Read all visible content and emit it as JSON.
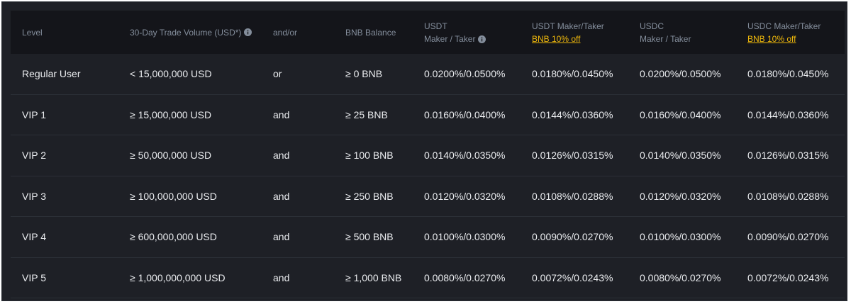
{
  "table": {
    "headers": {
      "level": "Level",
      "volume": "30-Day Trade Volume (USD*)",
      "andor": "and/or",
      "bnb": "BNB Balance",
      "usdt_line1": "USDT",
      "usdt_line2": "Maker / Taker",
      "usdt_disc_line1": "USDT Maker/Taker",
      "usdt_disc_line2": "BNB 10% off",
      "usdc_line1": "USDC",
      "usdc_line2": "Maker / Taker",
      "usdc_disc_line1": "USDC Maker/Taker",
      "usdc_disc_line2": "BNB 10% off"
    },
    "rows": [
      {
        "level": "Regular User",
        "volume": "< 15,000,000 USD",
        "andor": "or",
        "bnb": "≥ 0 BNB",
        "usdt": "0.0200%/0.0500%",
        "usdt_disc": "0.0180%/0.0450%",
        "usdc": "0.0200%/0.0500%",
        "usdc_disc": "0.0180%/0.0450%"
      },
      {
        "level": "VIP 1",
        "volume": "≥ 15,000,000 USD",
        "andor": "and",
        "bnb": "≥ 25 BNB",
        "usdt": "0.0160%/0.0400%",
        "usdt_disc": "0.0144%/0.0360%",
        "usdc": "0.0160%/0.0400%",
        "usdc_disc": "0.0144%/0.0360%"
      },
      {
        "level": "VIP 2",
        "volume": "≥ 50,000,000 USD",
        "andor": "and",
        "bnb": "≥ 100 BNB",
        "usdt": "0.0140%/0.0350%",
        "usdt_disc": "0.0126%/0.0315%",
        "usdc": "0.0140%/0.0350%",
        "usdc_disc": "0.0126%/0.0315%"
      },
      {
        "level": "VIP 3",
        "volume": "≥ 100,000,000 USD",
        "andor": "and",
        "bnb": "≥ 250 BNB",
        "usdt": "0.0120%/0.0320%",
        "usdt_disc": "0.0108%/0.0288%",
        "usdc": "0.0120%/0.0320%",
        "usdc_disc": "0.0108%/0.0288%"
      },
      {
        "level": "VIP 4",
        "volume": "≥ 600,000,000 USD",
        "andor": "and",
        "bnb": "≥ 500 BNB",
        "usdt": "0.0100%/0.0300%",
        "usdt_disc": "0.0090%/0.0270%",
        "usdc": "0.0100%/0.0300%",
        "usdc_disc": "0.0090%/0.0270%"
      },
      {
        "level": "VIP 5",
        "volume": "≥ 1,000,000,000 USD",
        "andor": "and",
        "bnb": "≥ 1,000 BNB",
        "usdt": "0.0080%/0.0270%",
        "usdt_disc": "0.0072%/0.0243%",
        "usdc": "0.0080%/0.0270%",
        "usdc_disc": "0.0072%/0.0243%"
      }
    ]
  },
  "icons": {
    "info": "info-icon"
  },
  "colors": {
    "background": "#1e2026",
    "header_background": "#14151a",
    "text": "#eaecef",
    "muted_text": "#848e9c",
    "accent": "#f0b90b"
  }
}
